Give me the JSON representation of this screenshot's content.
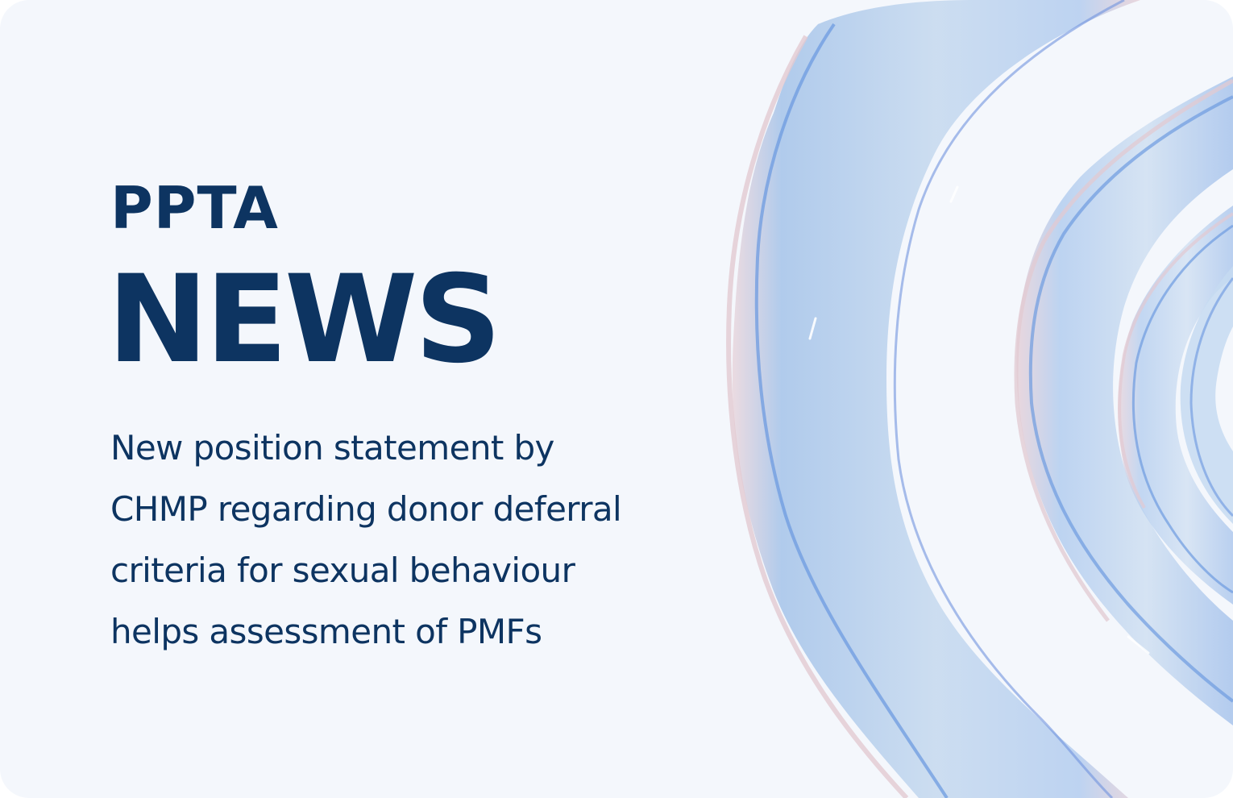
{
  "card": {
    "kicker": "PPTA",
    "headline": "NEWS",
    "summary_lines": [
      "New position statement by",
      "CHMP regarding donor deferral",
      "criteria for sexual behaviour",
      "helps assessment of PMFs"
    ]
  },
  "colors": {
    "background": "#f4f7fc",
    "text": "#0d3461",
    "ribbon_fill": "#c9dcef",
    "ribbon_edge": "#6d9be0",
    "ribbon_rim": "#e6cfd6"
  },
  "decoration": {
    "icon": "glass-ribbon-waves"
  }
}
